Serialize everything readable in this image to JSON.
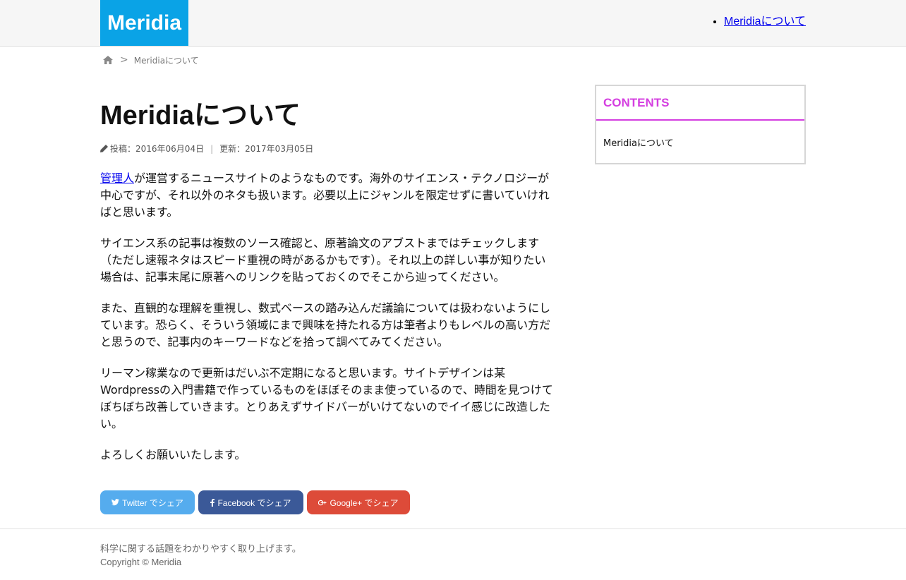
{
  "header": {
    "logo": "Meridia",
    "nav": [
      {
        "label": "Meridiaについて"
      }
    ]
  },
  "breadcrumb": {
    "home_icon": "home-icon",
    "separator": ">",
    "current": "Meridiaについて"
  },
  "article": {
    "title": "Meridiaについて",
    "meta": {
      "pencil_icon": "pencil-icon",
      "posted": "投稿：2016年06月04日",
      "divider": "|",
      "updated": "更新：2017年03月05日"
    },
    "p1_link": "管理人",
    "p1_rest": "が運営するニュースサイトのようなものです。海外のサイエンス・テクノロジーが中心ですが、それ以外のネタも扱います。必要以上にジャンルを限定せずに書いていければと思います。",
    "p2": "サイエンス系の記事は複数のソース確認と、原著論文のアブストまではチェックします（ただし速報ネタはスピード重視の時があるかもです）。それ以上の詳しい事が知りたい場合は、記事末尾に原著へのリンクを貼っておくのでそこから辿ってください。",
    "p3": "また、直観的な理解を重視し、数式ベースの踏み込んだ議論については扱わないようにしています。恐らく、そういう領域にまで興味を持たれる方は筆者よりもレベルの高い方だと思うので、記事内のキーワードなどを拾って調べてみてください。",
    "p4": "リーマン稼業なので更新はだいぶ不定期になると思います。サイトデザインは某Wordpressの入門書籍で作っているものをほぼそのまま使っているので、時間を見つけてぼちぼち改善していきます。とりあえずサイドバーがいけてないのでイイ感じに改造したい。",
    "p5": "よろしくお願いいたします。"
  },
  "share": {
    "twitter": "Twitter でシェア",
    "facebook": "Facebook でシェア",
    "google": "Google+ でシェア",
    "colors": {
      "twitter": "#55acee",
      "facebook": "#3b5998",
      "google": "#dd4b39"
    }
  },
  "sidebar": {
    "title": "CONTENTS",
    "items": [
      {
        "label": "Meridiaについて"
      }
    ],
    "accent": "#d43ee0"
  },
  "footer": {
    "description": "科学に関する話題をわかりやすく取り上げます。",
    "copyright": "Copyright © Meridia"
  },
  "brand_color": "#0aa3e6"
}
